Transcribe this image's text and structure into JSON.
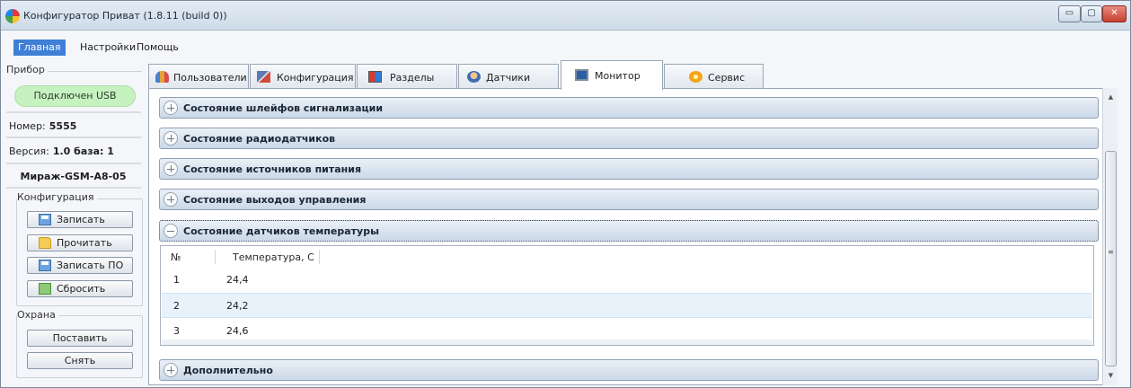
{
  "window": {
    "title": "Конфигуратор Приват (1.8.11 (build 0))",
    "controls": {
      "minimize": "▭",
      "maximize": "▢",
      "close": "✕"
    }
  },
  "menu": {
    "items": [
      "Главная",
      "Настройки",
      "Помощь"
    ],
    "active": "Главная"
  },
  "device": {
    "group_label": "Прибор",
    "connection": "Подключен USB",
    "number_label": "Номер:",
    "number_value": "5555",
    "version_label": "Версия:",
    "version_value": "1.0 база: 1",
    "model": "Мираж-GSM-A8-05"
  },
  "configuration": {
    "group_label": "Конфигурация",
    "buttons": [
      "Записать",
      "Прочитать",
      "Записать ПО",
      "Сбросить"
    ]
  },
  "security": {
    "group_label": "Охрана",
    "buttons": [
      "Поставить",
      "Снять"
    ]
  },
  "tabs": [
    {
      "label": "Пользователи",
      "icon": "users-icon"
    },
    {
      "label": "Конфигурация",
      "icon": "config-icon"
    },
    {
      "label": "Разделы",
      "icon": "partitions-icon"
    },
    {
      "label": "Датчики",
      "icon": "sensors-icon"
    },
    {
      "label": "Монитор",
      "icon": "monitor-icon",
      "selected": true
    },
    {
      "label": "Сервис",
      "icon": "service-icon"
    }
  ],
  "sections": [
    {
      "title": "Состояние шлейфов сигнализации",
      "expanded": false
    },
    {
      "title": "Состояние радиодатчиков",
      "expanded": false
    },
    {
      "title": "Состояние источников питания",
      "expanded": false
    },
    {
      "title": "Состояние выходов управления",
      "expanded": false
    },
    {
      "title": "Состояние датчиков температуры",
      "expanded": true
    },
    {
      "title": "Дополнительно",
      "expanded": false
    }
  ],
  "temperature_table": {
    "columns": [
      "№",
      "Температура, С"
    ],
    "rows": [
      {
        "n": "1",
        "temp": "24,4"
      },
      {
        "n": "2",
        "temp": "24,2",
        "highlighted": true
      },
      {
        "n": "3",
        "temp": "24,6"
      }
    ]
  },
  "scrollbar": {
    "up": "▲",
    "grip": "≡",
    "down": "▼"
  }
}
